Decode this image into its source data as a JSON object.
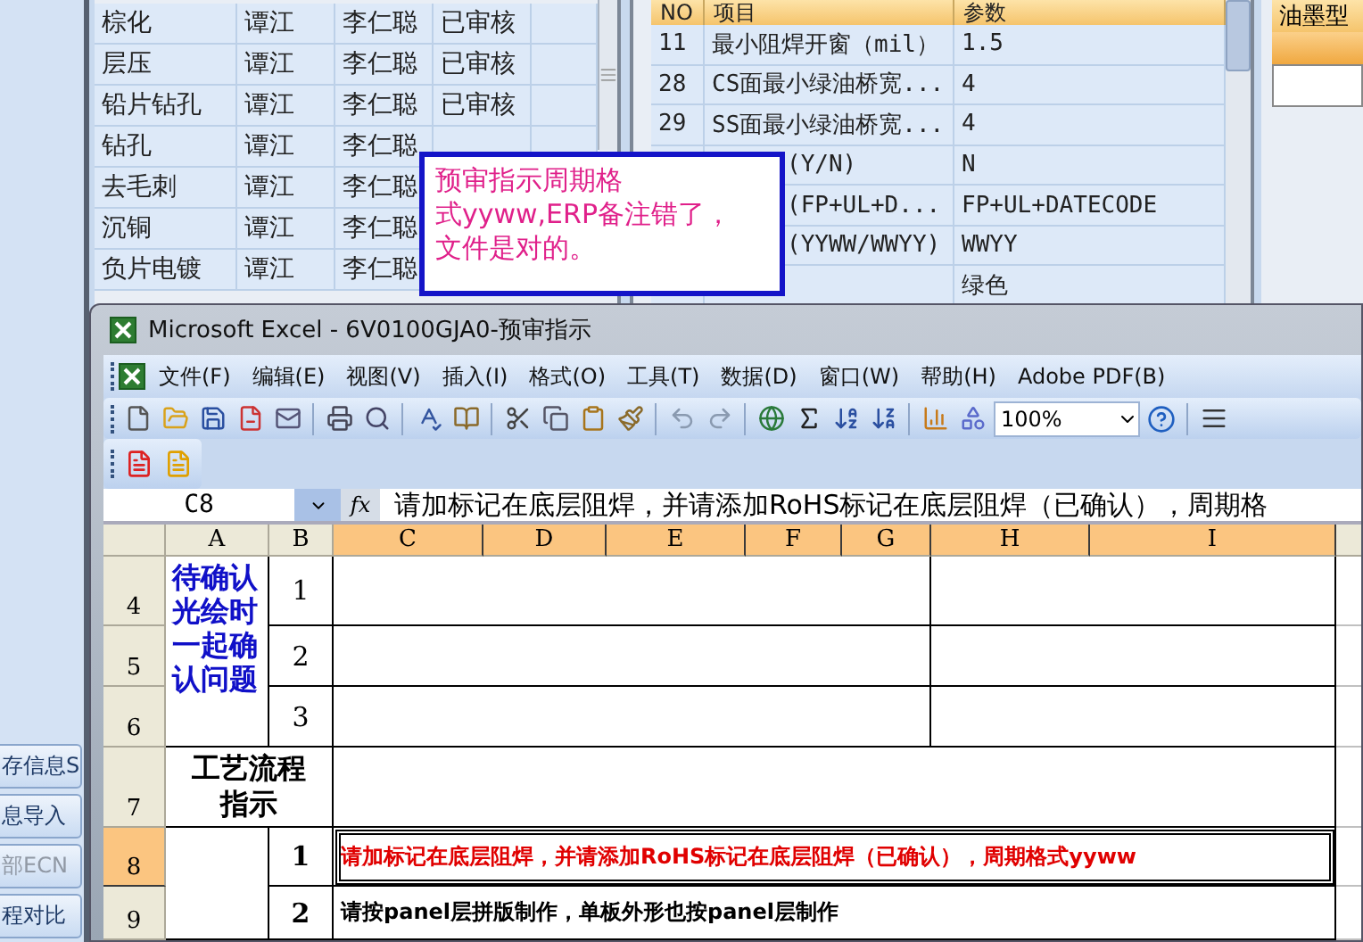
{
  "side_buttons": [
    {
      "label": "存信息S",
      "disabled": false
    },
    {
      "label": "息导入",
      "disabled": false
    },
    {
      "label": "部ECN",
      "disabled": true
    },
    {
      "label": "程对比",
      "disabled": false
    }
  ],
  "process_table": {
    "rows": [
      {
        "process": "棕化",
        "engineer": "谭江",
        "reviewer": "李仁聪",
        "status": "已审核"
      },
      {
        "process": "层压",
        "engineer": "谭江",
        "reviewer": "李仁聪",
        "status": "已审核"
      },
      {
        "process": "铅片钻孔",
        "engineer": "谭江",
        "reviewer": "李仁聪",
        "status": "已审核"
      },
      {
        "process": "钻孔",
        "engineer": "谭江",
        "reviewer": "李仁聪"
      },
      {
        "process": "去毛刺",
        "engineer": "谭江",
        "reviewer": "李仁聪"
      },
      {
        "process": "沉铜",
        "engineer": "谭江",
        "reviewer": "李仁聪"
      },
      {
        "process": "负片电镀",
        "engineer": "谭江",
        "reviewer": "李仁聪"
      }
    ]
  },
  "param_table": {
    "columns": [
      "NO",
      "项目",
      "参数"
    ],
    "rows": [
      {
        "no": "11",
        "item": "最小阻焊开窗（mil）",
        "value": "1.5"
      },
      {
        "no": "28",
        "item": "CS面最小绿油桥宽...",
        "value": "4"
      },
      {
        "no": "29",
        "item": "SS面最小绿油桥宽...",
        "value": "4"
      },
      {
        "item": "(Y/N)",
        "value": "N"
      },
      {
        "item": "(FP+UL+D...",
        "value": "FP+UL+DATECODE"
      },
      {
        "item": "(YYWW/WWYY)",
        "value": "WWYY"
      },
      {
        "value": "绿色"
      }
    ]
  },
  "ink_panel": {
    "header": "油墨型"
  },
  "callout": {
    "lines": [
      "预审指示周期格",
      "式yyww,ERP备注错了，",
      "文件是对的。"
    ]
  },
  "excel": {
    "title": "Microsoft Excel - 6V0100GJA0-预审指示",
    "menu": [
      "文件(F)",
      "编辑(E)",
      "视图(V)",
      "插入(I)",
      "格式(O)",
      "工具(T)",
      "数据(D)",
      "窗口(W)",
      "帮助(H)",
      "Adobe PDF(B)"
    ],
    "zoom": "100%",
    "name_box": "C8",
    "function_label": "fx",
    "formula": "请加标记在底层阻焊，并请添加RoHS标记在底层阻焊（已确认），周期格",
    "columns": [
      {
        "label": "A",
        "selected": false
      },
      {
        "label": "B",
        "selected": false
      },
      {
        "label": "C",
        "selected": true
      },
      {
        "label": "D",
        "selected": true
      },
      {
        "label": "E",
        "selected": true
      },
      {
        "label": "F",
        "selected": true
      },
      {
        "label": "G",
        "selected": true
      },
      {
        "label": "H",
        "selected": true
      },
      {
        "label": "I",
        "selected": true
      }
    ],
    "rows": [
      {
        "label": "4",
        "selected": false
      },
      {
        "label": "5",
        "selected": false
      },
      {
        "label": "6",
        "selected": false
      },
      {
        "label": "7",
        "selected": false
      },
      {
        "label": "8",
        "selected": true
      },
      {
        "label": "9",
        "selected": false
      }
    ],
    "pending_label": "待确认光绘时一起确认问题",
    "pending_numbers": [
      "1",
      "2",
      "3"
    ],
    "process_label": "工艺流程指示",
    "instructions": [
      {
        "no": "1",
        "text": "请加标记在底层阻焊，并请添加RoHS标记在底层阻焊（已确认），周期格式yyww",
        "color": "#e00000",
        "selected": true
      },
      {
        "no": "2",
        "text": "请按panel层拼版制作，单板外形也按panel层制作",
        "color": "#000000",
        "selected": false
      }
    ]
  }
}
